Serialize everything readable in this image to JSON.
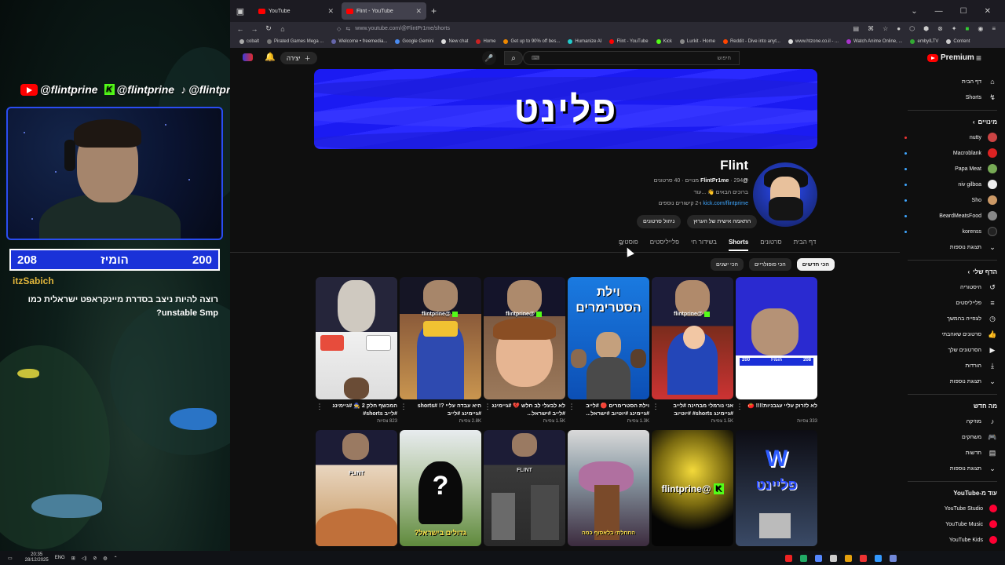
{
  "overlay": {
    "socials": [
      {
        "platform": "youtube",
        "handle": "@flintprine"
      },
      {
        "platform": "kick",
        "handle": "@flintprine"
      },
      {
        "platform": "tiktok",
        "handle": "@flintprine"
      }
    ],
    "score": {
      "left": "208",
      "center": "הומיז",
      "right": "200"
    },
    "chat": {
      "user": "itzSabich",
      "message": "רוצה להיות ניצב בסדרת מיינקראפט ישראלית כמו unstable Smp?"
    }
  },
  "browser": {
    "tabs": [
      {
        "label": "YouTube",
        "active": false
      },
      {
        "label": "Flint - YouTube",
        "active": true
      }
    ],
    "url": "www.youtube.com/@FlintPr1me/shorts",
    "bookmarks": [
      "cobalt",
      "Pirated Games Mega ...",
      "Welcome • freemedia...",
      "Google Gemini",
      "New chat",
      "Home",
      "Get up to 90% off bes...",
      "Humanize AI",
      "Flint - YouTube",
      "Kick",
      "Lurkit - Home",
      "Reddit - Dive into anyt...",
      "www.htzone.co.il - ...",
      "Watch Anime Online, ...",
      "embyILTV",
      "Content"
    ]
  },
  "youtube": {
    "search_placeholder": "חיפוש",
    "create_label": "יצירה",
    "premium_label": "Premium",
    "banner_text": "פלינט",
    "channel": {
      "name": "Flint",
      "handle": "@FlintPr1me",
      "stats": "· 294 מנויים · 40 סרטונים",
      "description": "ברוכים הבאים 👋 ...עוד",
      "link_text": "kick.com/flintprime",
      "link_suffix": "ו-2 קישורים נוספים",
      "btn_customize": "התאמה אישית של הערוץ",
      "btn_manage": "ניהול סרטונים"
    },
    "tabs": [
      "דף הבית",
      "סרטונים",
      "Shorts",
      "בשידור חי",
      "פלייליסטים",
      "פוסטים"
    ],
    "active_tab": "Shorts",
    "chips": [
      "הכי חדשים",
      "הכי פופולריים",
      "הכי ישנים"
    ],
    "shorts": [
      {
        "title": "לא לזרוק עליי עגבניות!!!! 🍅",
        "views": "333 צפיות"
      },
      {
        "title": "אני נורמלי מבחינה #לייב #גיימינג shorts# #יוטיוב",
        "views": "1.5K צפיות"
      },
      {
        "title": "וילת הסטרימרים 🔴 #לייב #גיימינג #יוטיוב #ישראל...",
        "views": "1.3K צפיות"
      },
      {
        "title": "לא לבעלי לב חלש 💔 #גיימינג #לייב #ישראל...",
        "views": "1.5K צפיות"
      },
      {
        "title": "היא עבדה עליי ?! #shorts #גיימינג #לייב",
        "views": "2.8K צפיות"
      },
      {
        "title": "המכשף חלק 2 🧙 #גיימינג #לייב shorts#",
        "views": "823 צפיות"
      },
      {
        "title": "",
        "views": ""
      },
      {
        "title": "",
        "views": ""
      },
      {
        "title": "",
        "views": ""
      },
      {
        "title": "",
        "views": ""
      },
      {
        "title": "",
        "views": ""
      },
      {
        "title": "",
        "views": ""
      }
    ],
    "thumb_texts": {
      "villa": "וילת הסטרימרים",
      "flint_tag": "@flintprine",
      "kick_tag": "@flintprine",
      "question": "?",
      "big_israel": "גדולים בישראל?",
      "finally": "התחלתי בלאסוף כמה",
      "flint_word": "פליינט",
      "flint_label": "FLINT",
      "score_left": "208",
      "score_mid": "הומיז",
      "score_right": "200"
    },
    "sidebar": {
      "main": [
        {
          "label": "דף הבית",
          "icon": "home-icon",
          "glyph": "⌂"
        },
        {
          "label": "Shorts",
          "icon": "shorts-icon",
          "glyph": "↯"
        }
      ],
      "subs_header": "מינויים",
      "subscriptions": [
        {
          "label": "nutty",
          "color": "#c44"
        },
        {
          "label": "Macroblank",
          "color": "#d22"
        },
        {
          "label": "Papa Meat",
          "color": "#7a5"
        },
        {
          "label": "niv gilboa",
          "color": "#eee"
        },
        {
          "label": "Sho",
          "color": "#c96"
        },
        {
          "label": "BeardMeatsFood",
          "color": "#888"
        },
        {
          "label": "korenss",
          "color": "#222"
        }
      ],
      "show_more": "תצוגת נוספות",
      "you_header": "הדף שלי",
      "you_items": [
        {
          "label": "היסטוריה",
          "icon": "history-icon",
          "glyph": "↺"
        },
        {
          "label": "פלייליסטים",
          "icon": "playlist-icon",
          "glyph": "≡"
        },
        {
          "label": "לצפייה בהמשך",
          "icon": "watch-later-icon",
          "glyph": "◷"
        },
        {
          "label": "סרטונים שאהבתי",
          "icon": "like-icon",
          "glyph": "👍"
        },
        {
          "label": "הסרטונים שלך",
          "icon": "your-videos-icon",
          "glyph": "▶"
        },
        {
          "label": "הורדות",
          "icon": "download-icon",
          "glyph": "⤓"
        }
      ],
      "show_more2": "תצוגת נוספות",
      "explore_header": "מה חדש",
      "explore_items": [
        {
          "label": "מוזיקה",
          "icon": "music-icon",
          "glyph": "♪"
        },
        {
          "label": "משחקים",
          "icon": "gaming-icon",
          "glyph": "🎮"
        },
        {
          "label": "חדשות",
          "icon": "news-icon",
          "glyph": "▤"
        }
      ],
      "show_more3": "תצוגת נוספות",
      "more_header": "עוד מ-YouTube",
      "more_items": [
        "YouTube Studio",
        "YouTube Music",
        "YouTube Kids"
      ]
    }
  },
  "taskbar": {
    "time": "20:35",
    "date": "28/12/2025",
    "lang": "ENG"
  },
  "colors": {
    "accent_blue": "#1a32d8",
    "youtube_red": "#ff0000",
    "kick_green": "#53fc18",
    "link_blue": "#3ea6ff"
  }
}
